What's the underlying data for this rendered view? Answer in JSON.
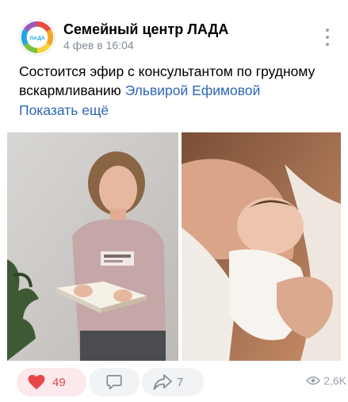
{
  "post": {
    "author": "Семейный центр ЛАДА",
    "date": "4 фев в 16:04",
    "avatar_text": "ЛАДА",
    "text_before_link": "Состоится эфир с консультантом по грудному вскармливанию ",
    "text_link": "Эльвирой Ефимовой",
    "show_more": "Показать ещё",
    "photos": [
      {
        "icon": "photo-consultant-with-book"
      },
      {
        "icon": "photo-breastfeeding-baby"
      }
    ]
  },
  "actions": {
    "likes": "49",
    "shares": "7",
    "views": "2,6K"
  },
  "colors": {
    "like": "#e64646",
    "link": "#2d66b5",
    "muted": "#818c99"
  }
}
